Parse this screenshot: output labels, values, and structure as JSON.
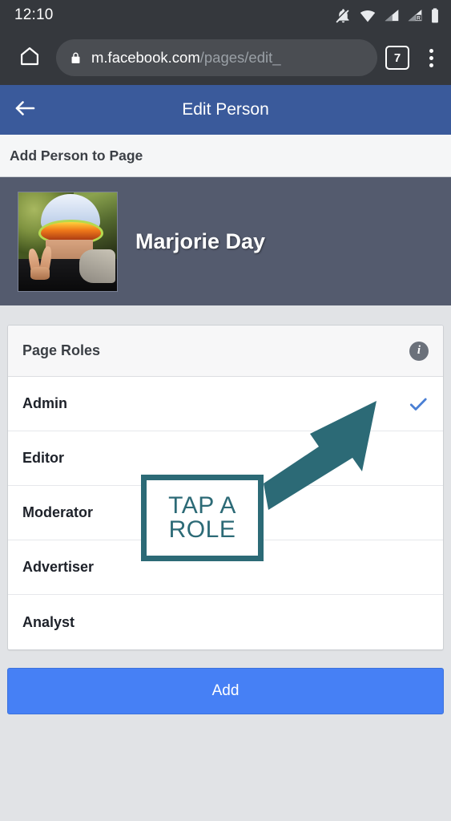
{
  "status_bar": {
    "clock": "12:10",
    "icons": [
      "bell-slash-icon",
      "wifi-icon",
      "signal-icon",
      "signal-roaming-icon",
      "battery-icon"
    ]
  },
  "browser": {
    "home_icon": "home-icon",
    "lock_icon": "lock-icon",
    "url_host": "m.facebook.com",
    "url_path": "/pages/edit_",
    "tab_count": "7",
    "menu_icon": "overflow-menu-icon"
  },
  "app_bar": {
    "back_icon": "back-arrow-icon",
    "title": "Edit Person"
  },
  "sub_header": {
    "label": "Add Person to Page"
  },
  "profile": {
    "name": "Marjorie Day",
    "avatar_alt": "profile-photo"
  },
  "page_roles_card": {
    "title": "Page Roles",
    "info_icon": "info-icon",
    "info_glyph": "i",
    "selected_role": "Admin",
    "check_color": "#4a7fd4",
    "roles": [
      {
        "label": "Admin",
        "selected": true
      },
      {
        "label": "Editor",
        "selected": false
      },
      {
        "label": "Moderator",
        "selected": false
      },
      {
        "label": "Advertiser",
        "selected": false
      },
      {
        "label": "Analyst",
        "selected": false
      }
    ]
  },
  "footer": {
    "add_label": "Add",
    "add_color": "#4680f5"
  },
  "annotation": {
    "line1": "TAP A",
    "line2": "ROLE",
    "color": "#2c6a76",
    "arrow": "arrow-pointing-to-admin-checkmark"
  }
}
